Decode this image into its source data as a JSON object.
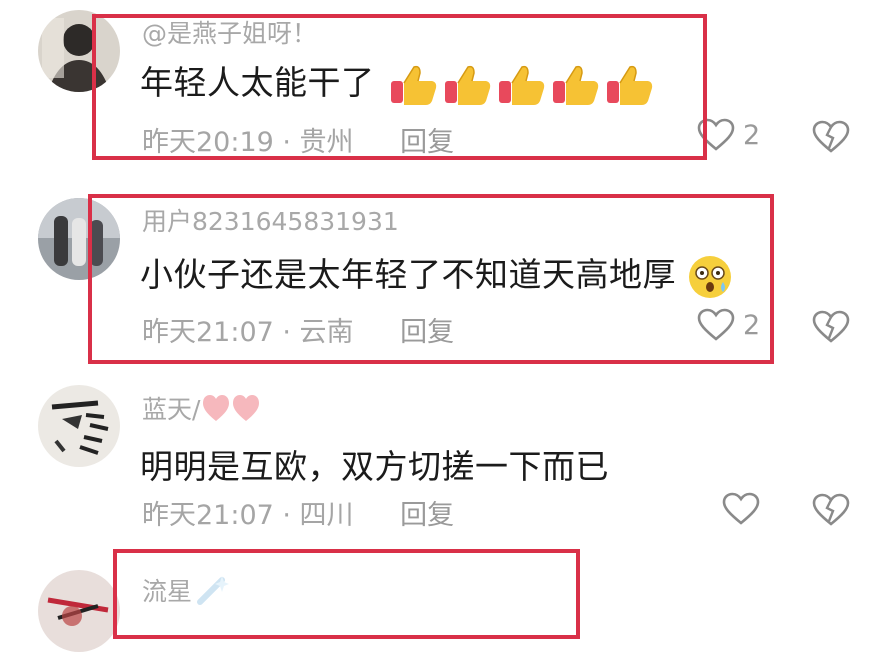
{
  "comments": [
    {
      "username": "@是燕子姐呀！",
      "text": "年轻人太能干了",
      "time_location": "昨天20:19 · 贵州",
      "reply_label": "回复",
      "like_count": "2",
      "emoji": "thumbs-up-icon",
      "emoji_count": 5,
      "highlighted": true
    },
    {
      "username": "用户8231645831931",
      "text": "小伙子还是太年轻了不知道天高地厚",
      "time_location": "昨天21:07 · 云南",
      "reply_label": "回复",
      "like_count": "2",
      "emoji": "surprised-face-icon",
      "highlighted": true
    },
    {
      "username": "蓝天/",
      "text": "明明是互欧，双方切搓一下而已",
      "time_location": "昨天21:07 · 四川",
      "reply_label": "回复",
      "like_count": "",
      "username_emoji": "pink-hearts-icon",
      "highlighted": false
    },
    {
      "username": "流星",
      "username_emoji": "sparkle-icon",
      "highlighted": true
    }
  ],
  "colors": {
    "highlight_border": "#d93048",
    "meta_text": "#a5a5a5",
    "username_text": "#a8a8a8"
  }
}
